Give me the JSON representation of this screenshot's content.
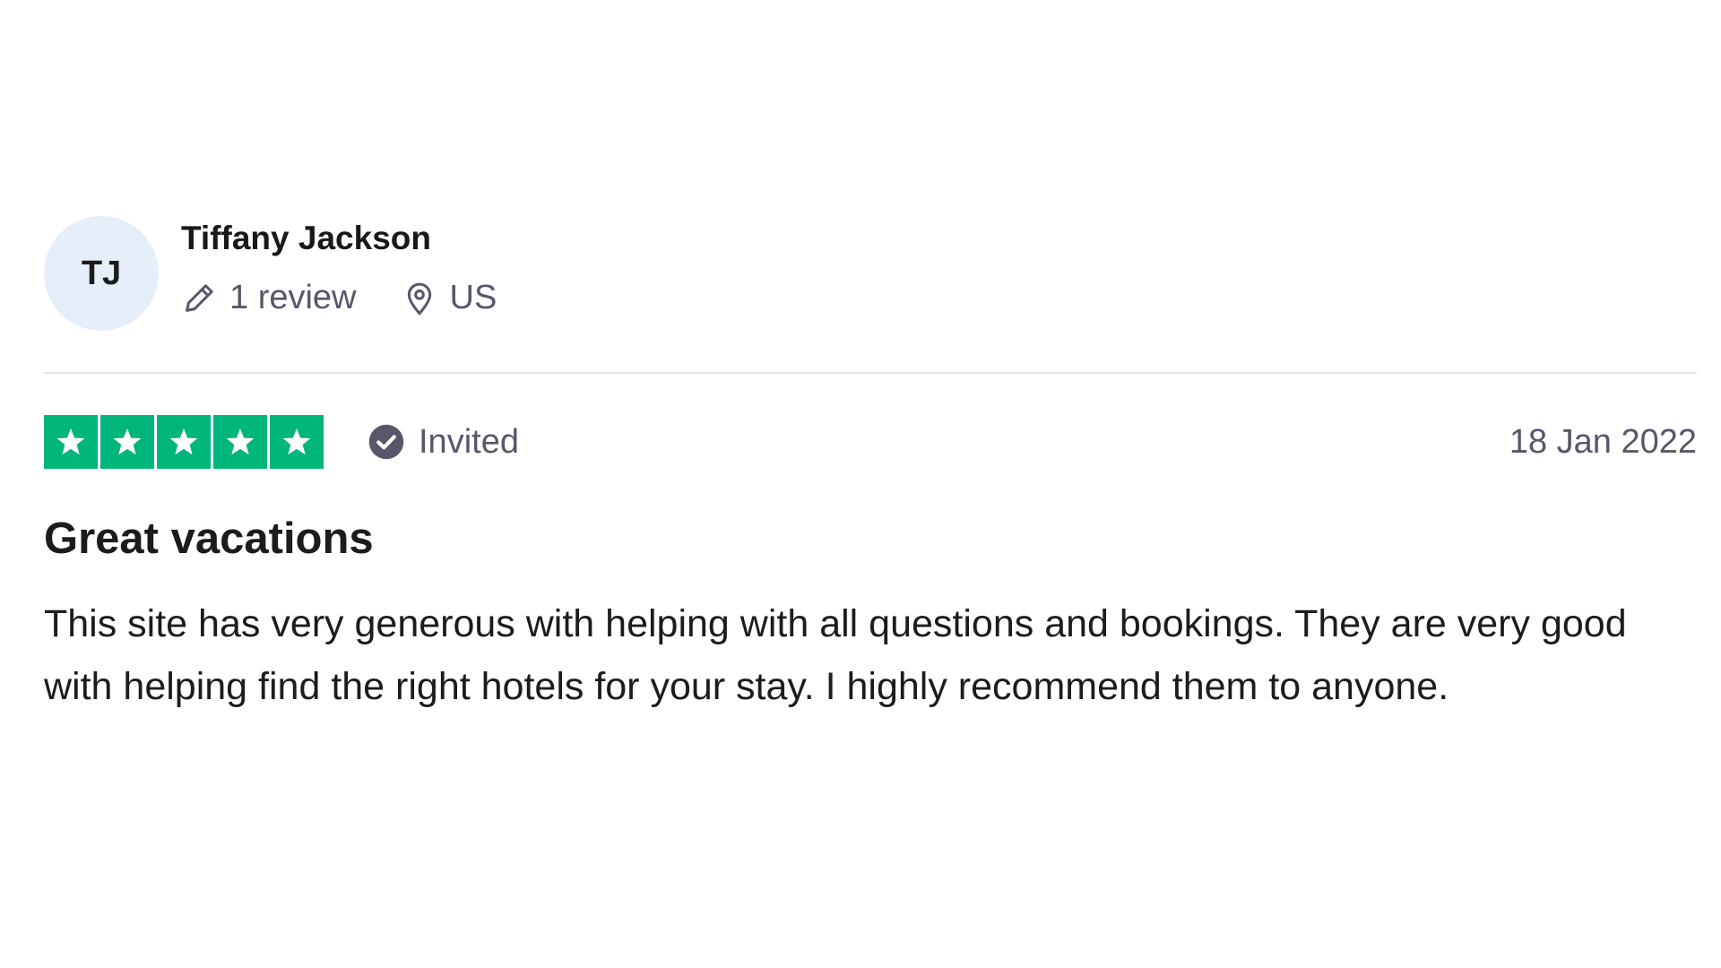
{
  "consumer": {
    "initials": "TJ",
    "avatar_color": "#e5eef9",
    "name": "Tiffany Jackson",
    "review_count": "1 review",
    "country": "US"
  },
  "review": {
    "rating": 5,
    "rating_max": 5,
    "star_color": "#00b67a",
    "status": "Invited",
    "date": "18 Jan 2022",
    "title": "Great vacations",
    "body": "This site has very generous with helping with all questions and bookings. They are very good with helping find the right hotels for your stay. I highly recommend them to anyone."
  },
  "icons": {
    "review_count": "pencil-icon",
    "country": "location-pin-icon",
    "status": "verified-check-icon"
  }
}
